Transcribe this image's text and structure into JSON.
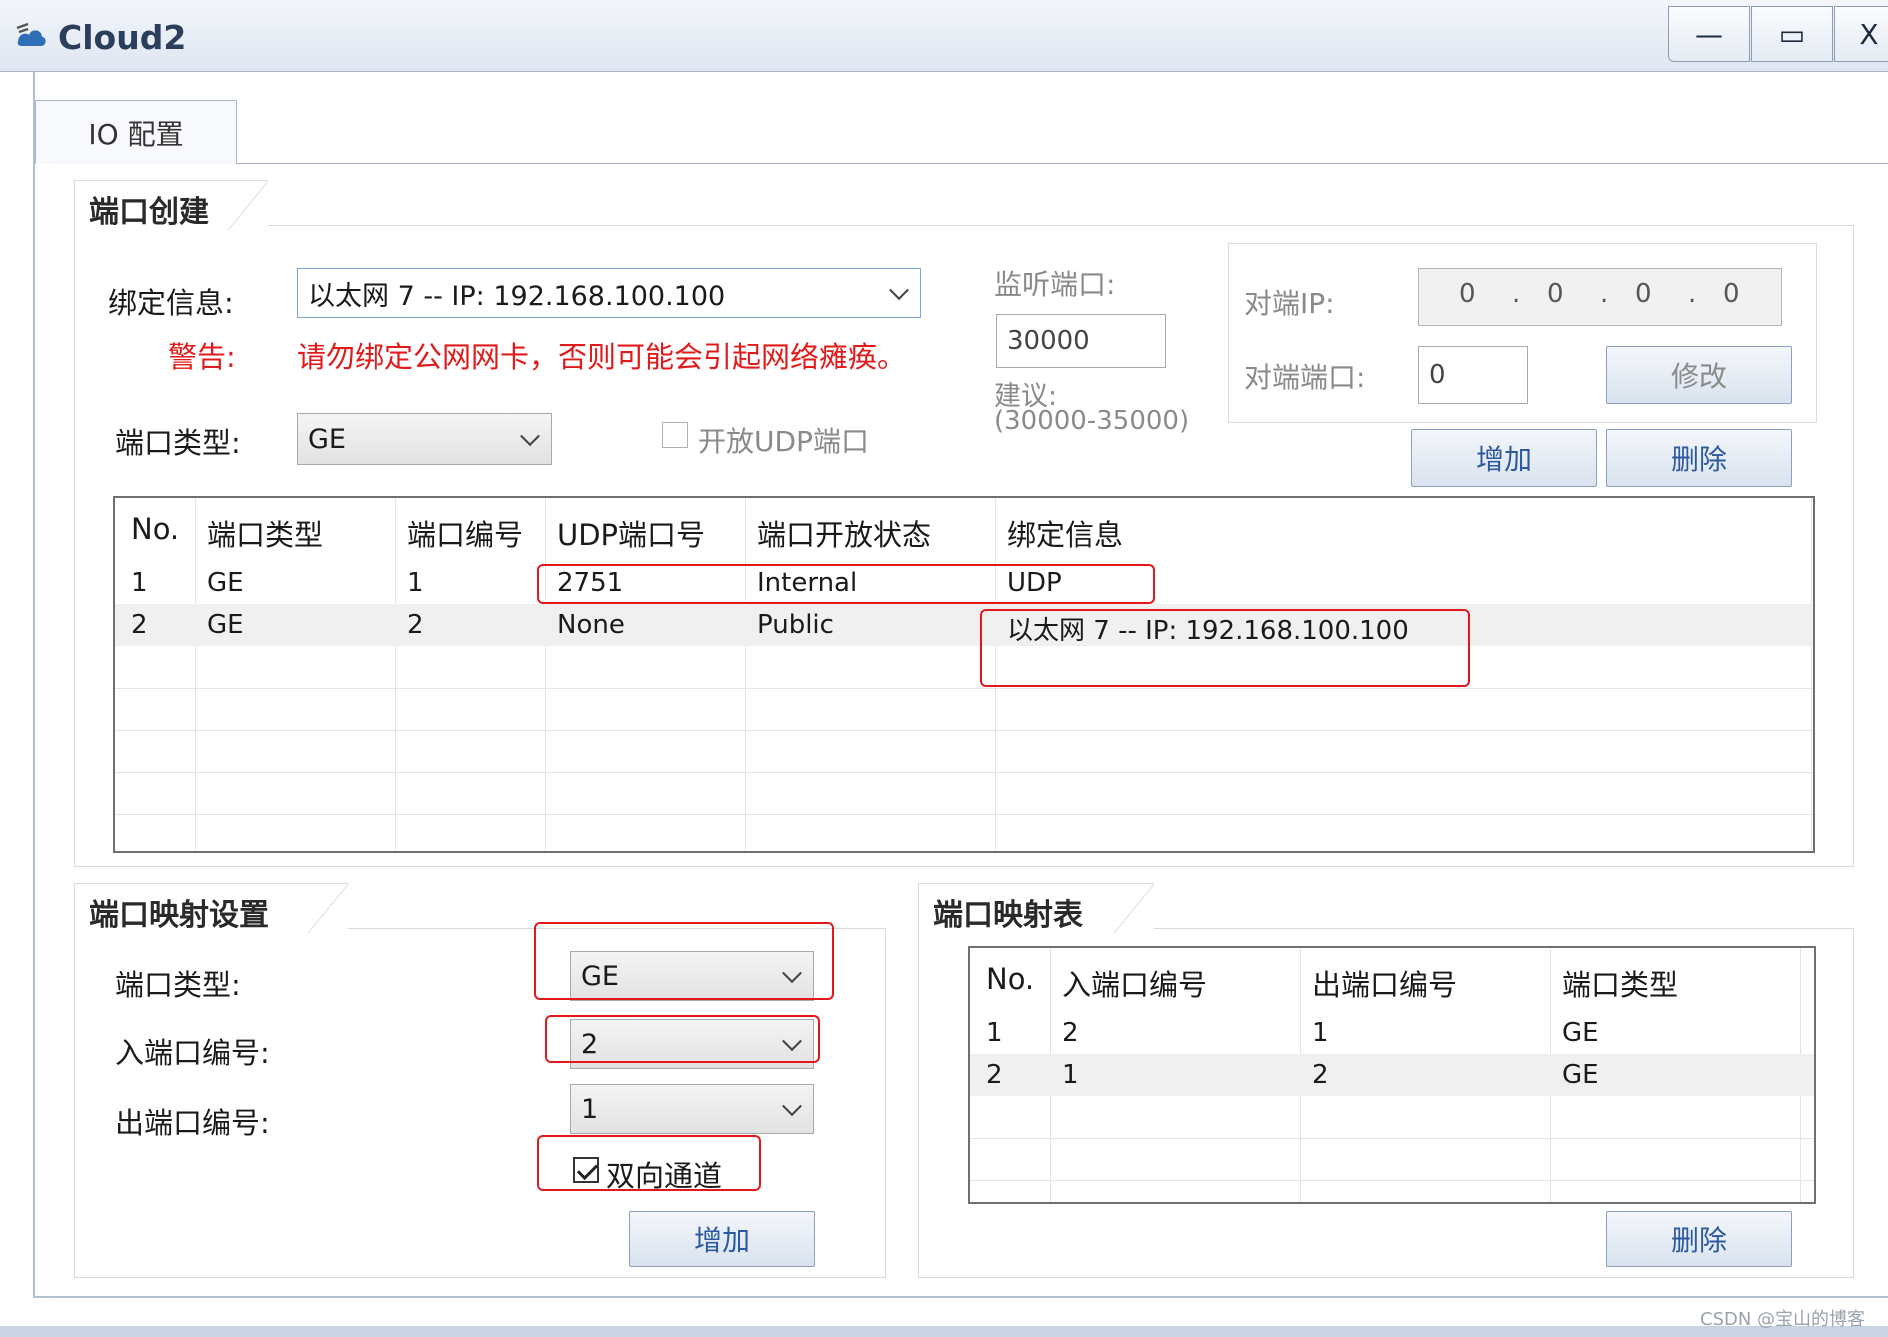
{
  "window": {
    "title": "Cloud2",
    "min_glyph": "—",
    "max_glyph": "▭",
    "close_glyph": "X"
  },
  "main_tab": {
    "label": "IO 配置"
  },
  "port_create": {
    "group_title": "端口创建",
    "bind_label": "绑定信息:",
    "bind_value": "以太网 7 -- IP: 192.168.100.100",
    "warning_label": "警告:",
    "warning_text": "请勿绑定公网网卡，否则可能会引起网络瘫痪。",
    "port_type_label": "端口类型:",
    "port_type_value": "GE",
    "open_udp_label": "开放UDP端口",
    "open_udp_checked": false,
    "listen_port_label": "监听端口:",
    "listen_port_value": "30000",
    "suggest_label": "建议:",
    "suggest_range": "(30000-35000)",
    "peer_ip_label": "对端IP:",
    "peer_ip_octets": [
      "0",
      "0",
      "0",
      "0"
    ],
    "peer_ip_dot": ".",
    "peer_port_label": "对端端口:",
    "peer_port_value": "0",
    "modify_button": "修改",
    "add_button": "增加",
    "delete_button": "删除",
    "table": {
      "headers": [
        "No.",
        "端口类型",
        "端口编号",
        "UDP端口号",
        "端口开放状态",
        "绑定信息"
      ],
      "rows": [
        [
          "1",
          "GE",
          "1",
          "2751",
          "Internal",
          "UDP"
        ],
        [
          "2",
          "GE",
          "2",
          "None",
          "Public",
          "以太网 7 -- IP: 192.168.100.100"
        ]
      ]
    }
  },
  "port_map_settings": {
    "group_title": "端口映射设置",
    "port_type_label": "端口类型:",
    "port_type_value": "GE",
    "in_port_label": "入端口编号:",
    "in_port_value": "2",
    "out_port_label": "出端口编号:",
    "out_port_value": "1",
    "bidirectional_label": "双向通道",
    "bidirectional_checked": true,
    "add_button": "增加"
  },
  "port_map_table": {
    "group_title": "端口映射表",
    "headers": [
      "No.",
      "入端口编号",
      "出端口编号",
      "端口类型"
    ],
    "rows": [
      [
        "1",
        "2",
        "1",
        "GE"
      ],
      [
        "2",
        "1",
        "2",
        "GE"
      ]
    ],
    "delete_button": "删除"
  },
  "watermark": "CSDN @宝山的博客",
  "colors": {
    "warning": "#e11b1b",
    "highlight_box": "#e2191c",
    "button_text": "#2c5a9e"
  }
}
